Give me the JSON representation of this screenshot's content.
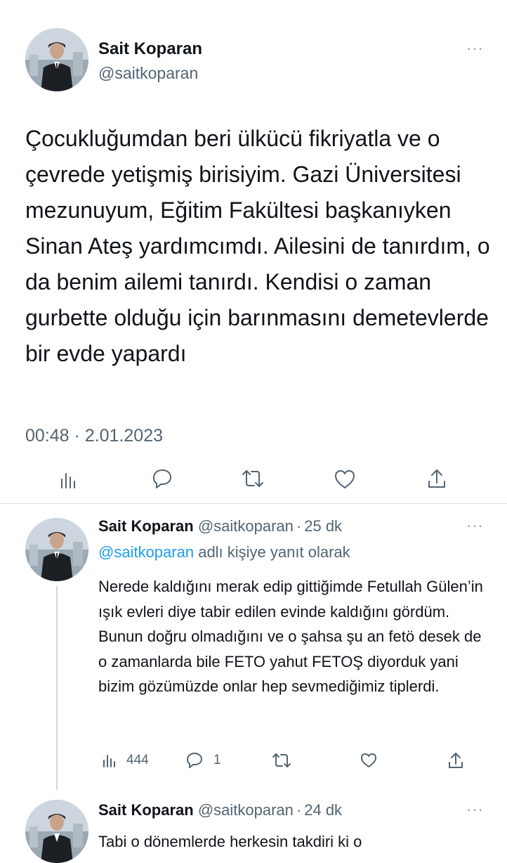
{
  "main_tweet": {
    "author_name": "Sait Koparan",
    "author_handle": "@saitkoparan",
    "more_icon": "more-dots-icon",
    "text": "Çocukluğumdan beri ülkücü fikriyatla ve o çevrede yetişmiş birisiyim. Gazi Üniversitesi mezunuyum, Eğitim Fakültesi başkanıyken Sinan Ateş yardımcımdı. Ailesini de tanırdım, o da benim ailemi tanırdı. Kendisi o zaman gurbette olduğu için barınmasını demetevlerde bir evde yapardı",
    "timestamp": "00:48 · 2.01.2023",
    "actions": [
      "analytics-icon",
      "reply-icon",
      "retweet-icon",
      "like-icon",
      "share-icon"
    ]
  },
  "reply_1": {
    "author_name": "Sait Koparan",
    "author_handle": "@saitkoparan",
    "separator": "·",
    "time_ago": "25 dk",
    "reply_to_handle": "@saitkoparan",
    "reply_to_suffix": "adlı kişiye yanıt olarak",
    "text": "Nerede kaldığını merak edip gittiğimde Fetullah Gülen’in ışık evleri diye tabir edilen evinde kaldığını gördüm. Bunun doğru olmadığını ve o şahsa şu an fetö desek de o zamanlarda bile FETO yahut FETOŞ diyorduk yani bizim gözümüzde onlar hep sevmediğimiz tiplerdi.",
    "views_count": "444",
    "reply_count": "1"
  },
  "reply_2": {
    "author_name": "Sait Koparan",
    "author_handle": "@saitkoparan",
    "separator": "·",
    "time_ago": "24 dk",
    "text_partial": "Tabi o dönemlerde herkesin takdiri ki o"
  },
  "colors": {
    "text": "#0f1419",
    "muted": "#536471",
    "link": "#1d9bf0",
    "divider": "#dfe3e6"
  }
}
